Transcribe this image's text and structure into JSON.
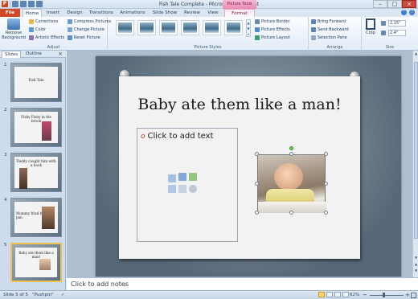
{
  "window": {
    "title": "Fish Tale Complete - Microsoft PowerPoint",
    "context_tab": "Picture Tools"
  },
  "tabs": [
    "File",
    "Home",
    "Insert",
    "Design",
    "Transitions",
    "Animations",
    "Slide Show",
    "Review",
    "View",
    "Format"
  ],
  "ribbon": {
    "adjust": {
      "remove_background": "Remove Background",
      "corrections": "Corrections",
      "color": "Color",
      "artistic_effects": "Artistic Effects",
      "compress": "Compress Pictures",
      "change": "Change Picture",
      "reset": "Reset Picture",
      "label": "Adjust"
    },
    "styles": {
      "label": "Picture Styles",
      "border": "Picture Border",
      "effects": "Picture Effects",
      "layout": "Picture Layout"
    },
    "arrange": {
      "label": "Arrange",
      "bring_forward": "Bring Forward",
      "send_backward": "Send Backward",
      "selection_pane": "Selection Pane"
    },
    "size": {
      "label": "Size",
      "crop": "Crop",
      "height": "2.15\"",
      "width": "2.4\""
    }
  },
  "pane": {
    "slides_tab": "Slides",
    "outline_tab": "Outline",
    "close": "×"
  },
  "thumbnails": [
    {
      "num": "1",
      "title": "Fish Tale"
    },
    {
      "num": "2",
      "title": "Fishy Fishy in the brook"
    },
    {
      "num": "3",
      "title": "Daddy caught him with a hook"
    },
    {
      "num": "4",
      "title": "Mommy fried him in a pan"
    },
    {
      "num": "5",
      "title": "Baby ate them like a man!"
    }
  ],
  "slide": {
    "title": "Baby ate them like a man!",
    "content_placeholder": "Click to add text"
  },
  "notes": {
    "placeholder": "Click to add notes"
  },
  "status": {
    "slide_info": "Slide 5 of 5",
    "theme": "\"Pushpin\"",
    "zoom": "62%"
  },
  "colors": {
    "file_tab": "#d24726",
    "context_tab": "#e98ab3",
    "selected_thumb_border": "#f2c34c",
    "rotate_handle": "#7fcf5b"
  }
}
